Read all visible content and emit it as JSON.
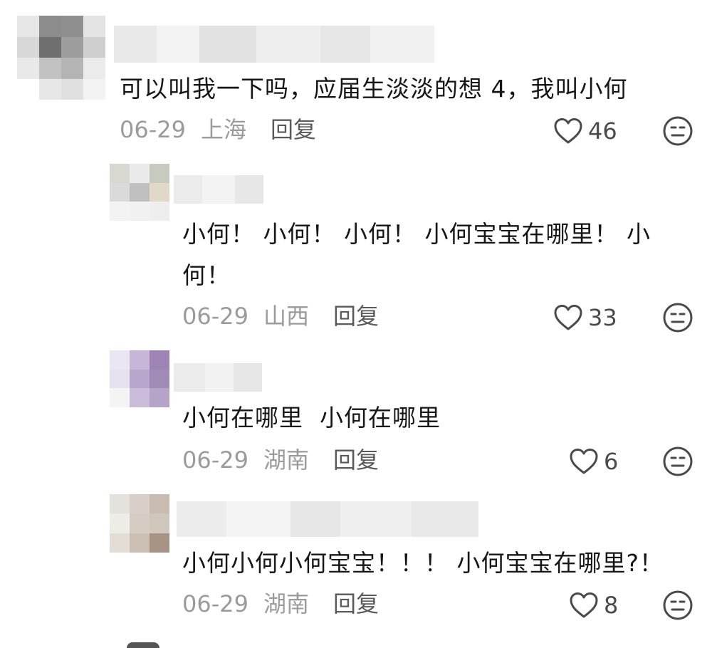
{
  "comments": [
    {
      "text": "可以叫我一下吗，应届生淡淡的想 4，我叫小何",
      "date": "06-29",
      "location": "上海",
      "reply_label": "回复",
      "likes": "46"
    },
    {
      "text": "小何！小何！小何！小何宝宝在哪里！小何！",
      "date": "06-29",
      "location": "山西",
      "reply_label": "回复",
      "likes": "33"
    },
    {
      "text": "小何在哪里 小何在哪里",
      "date": "06-29",
      "location": "湖南",
      "reply_label": "回复",
      "likes": "6"
    },
    {
      "text": "小何小何小何宝宝！！！ 小何宝宝在哪里?！",
      "date": "06-29",
      "location": "湖南",
      "reply_label": "回复",
      "likes": "8"
    }
  ],
  "comment_lines": {
    "c0_l1": "可以叫我一下吗，应届生淡淡的想 4，我叫小何",
    "c1_l1": "小何！ 小何！ 小何！ 小何宝宝在哪里！ 小",
    "c1_l2": "何！",
    "c2_l1": "小何在哪里  小何在哪里",
    "c3_l1": "小何小何小何宝宝！！！ 小何宝宝在哪里?！"
  },
  "icons": {
    "like": "heart-outline-icon",
    "dislike": "neutral-face-icon"
  },
  "colors": {
    "text": "#161616",
    "meta": "#9b9b9b",
    "reply": "#5a5a5a",
    "icon": "#4a4a4a"
  }
}
